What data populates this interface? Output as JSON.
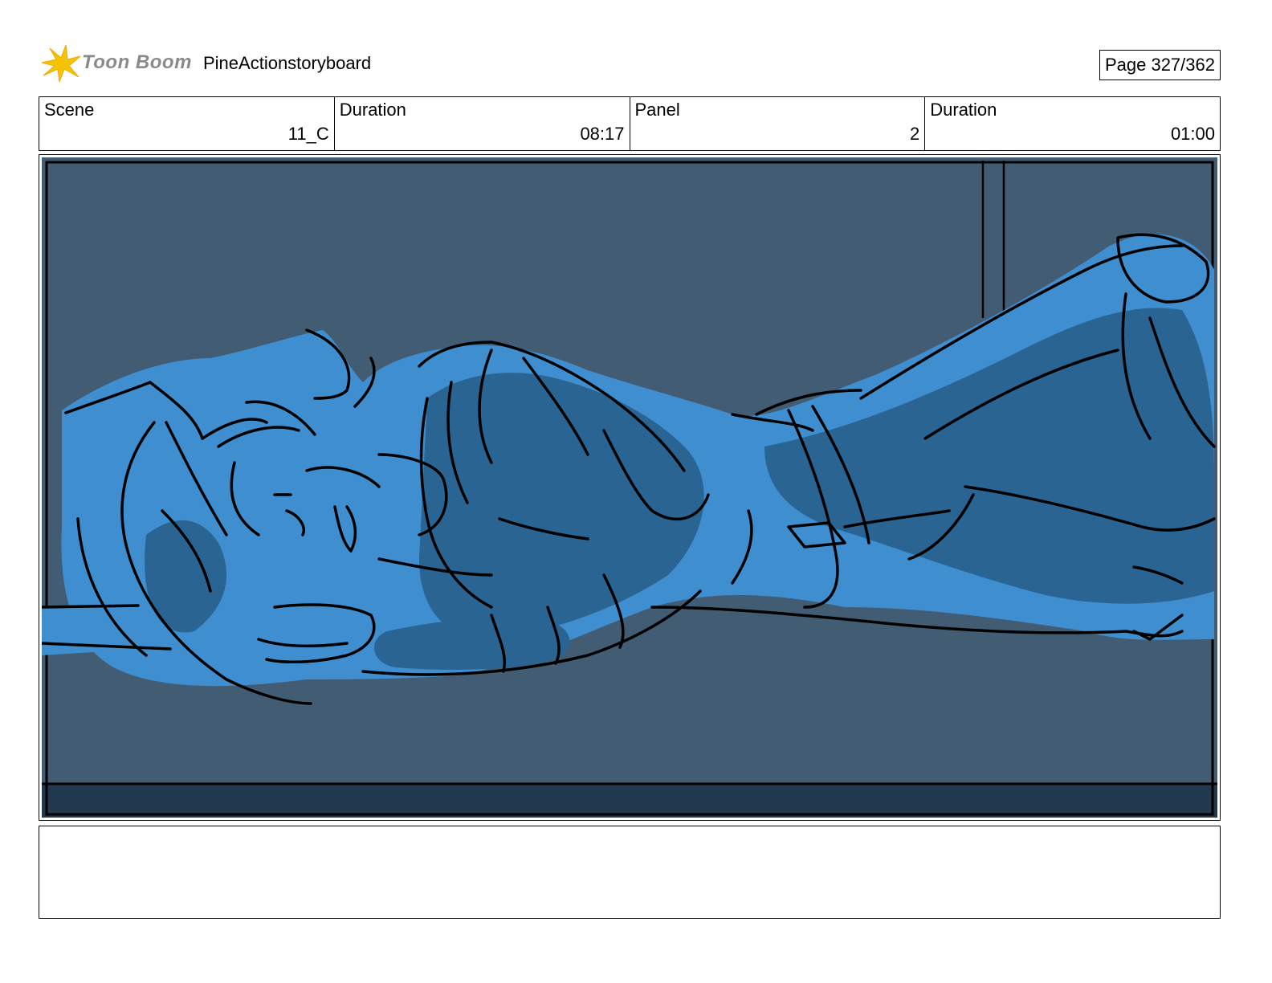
{
  "header": {
    "logo_text": "Toon Boom",
    "project_title": "PineActionstoryboard",
    "page_label": "Page 327/362"
  },
  "info": [
    {
      "label": "Scene",
      "value": "11_C"
    },
    {
      "label": "Duration",
      "value": "08:17"
    },
    {
      "label": "Panel",
      "value": "2"
    },
    {
      "label": "Duration",
      "value": "01:00"
    }
  ],
  "colors": {
    "background": "#425c74",
    "floor": "#21384f",
    "figure_light": "#3f8fd0",
    "figure_shadow": "#2a6492",
    "ink": "#000000"
  },
  "notes": {
    "text": ""
  }
}
